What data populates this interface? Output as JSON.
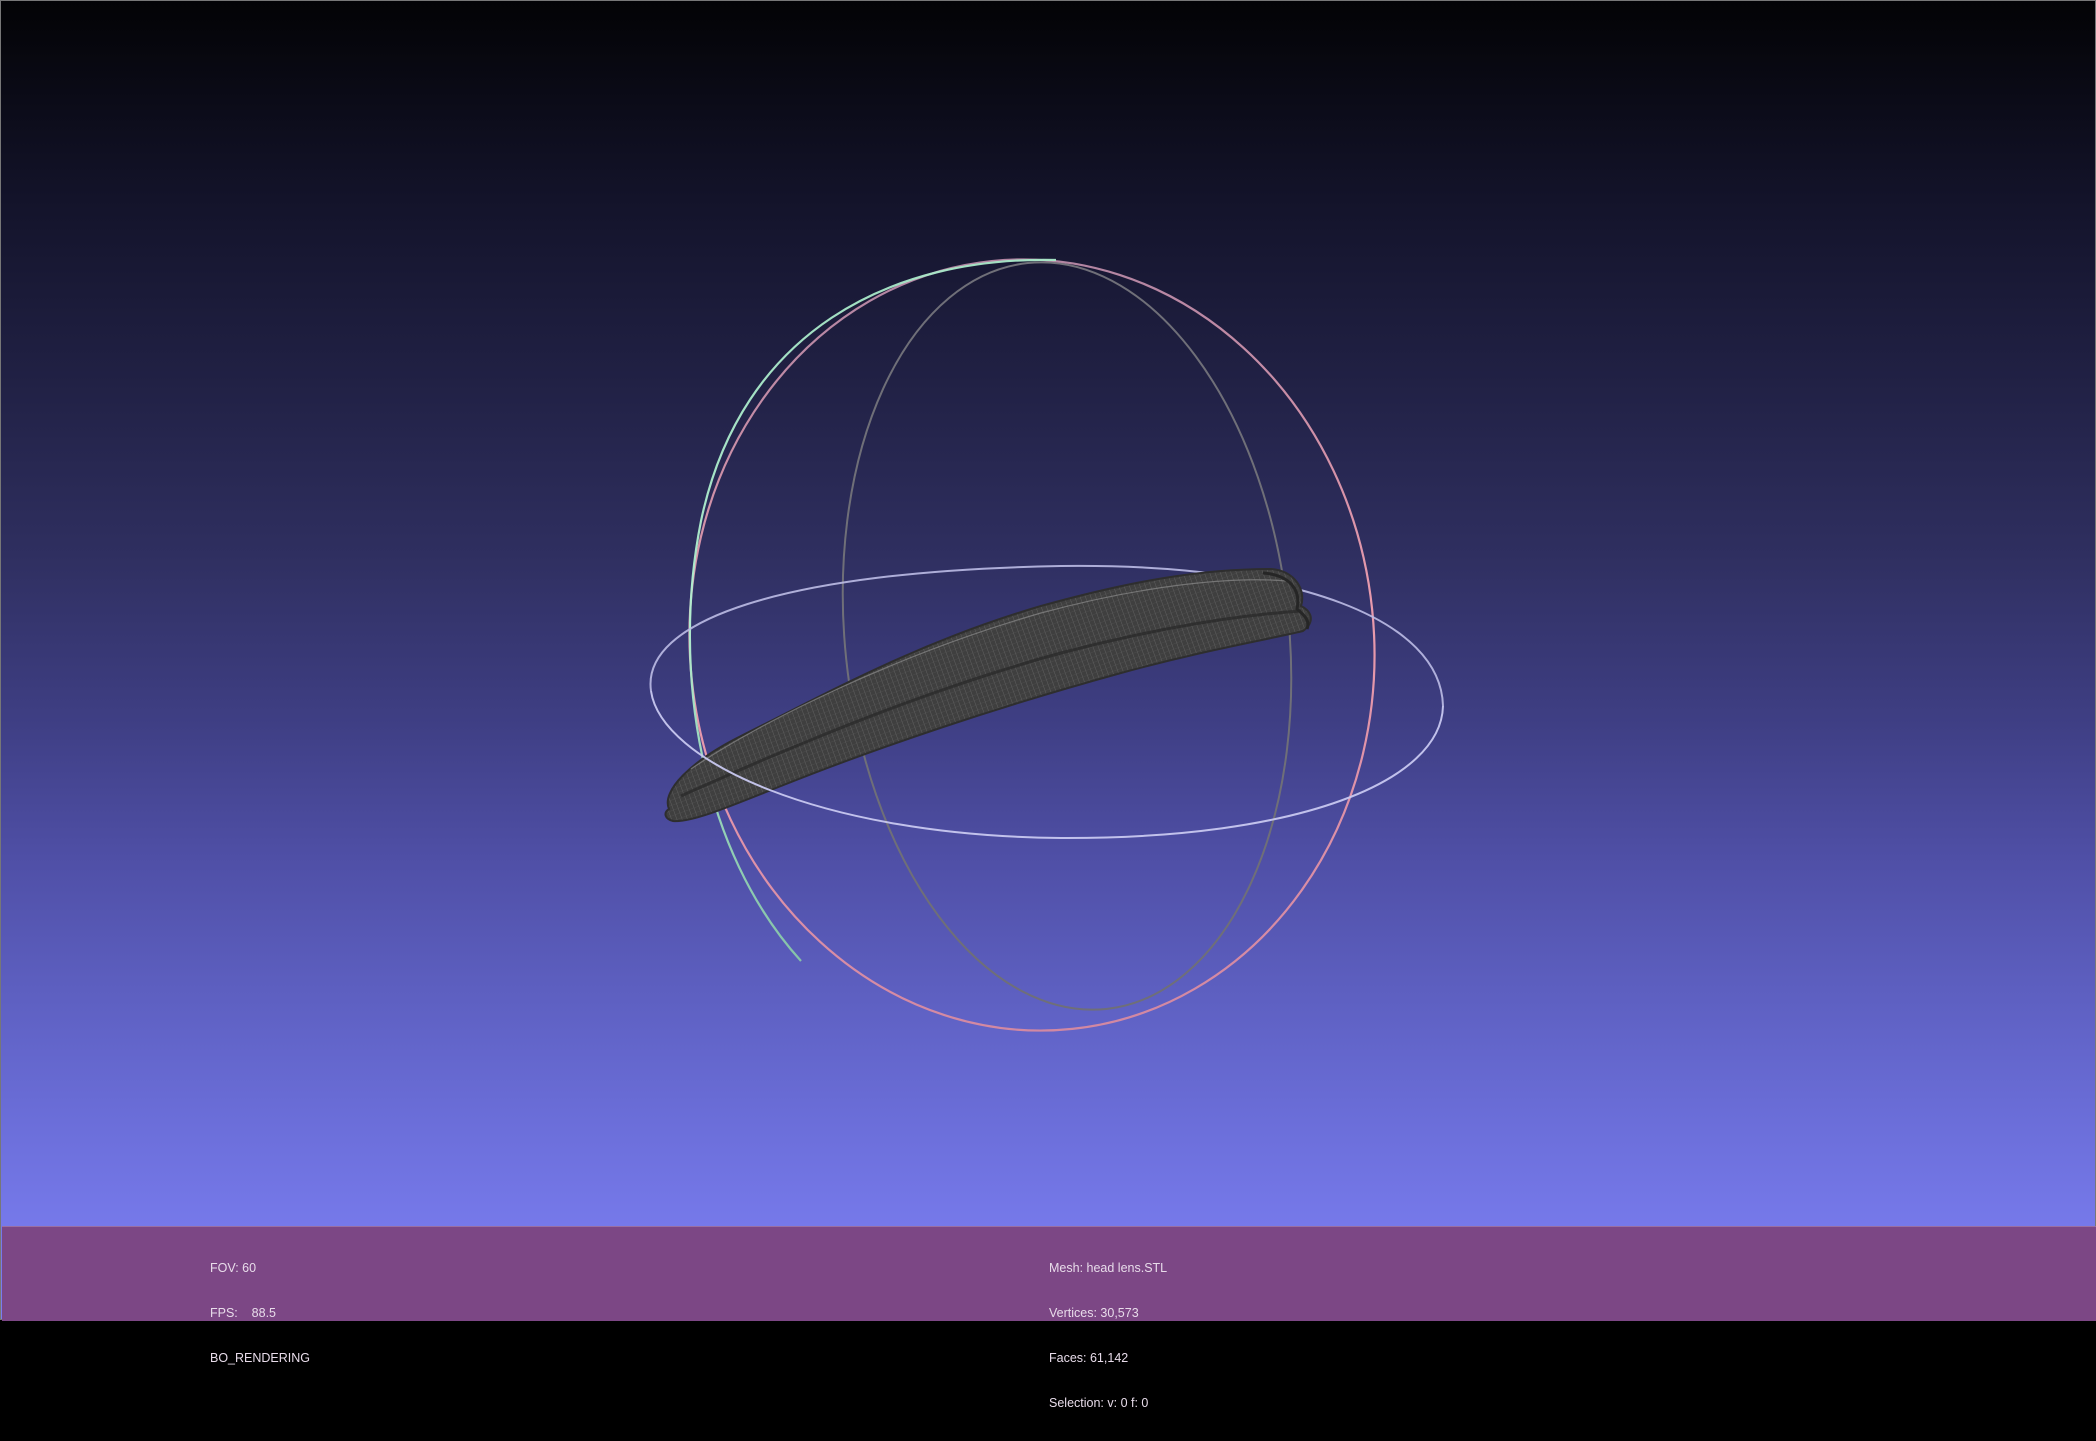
{
  "viewer": {
    "background_top_color": "#030305",
    "background_bottom_color": "#7a7ef0",
    "info_bar_color": "#7c4785",
    "mesh_color": "#4a4a4a",
    "trackball": {
      "x_ring_color": "#e89aa8",
      "y_ring_color": "#9ee8c0",
      "z_ring_color": "#c8c8f0"
    }
  },
  "info_left": {
    "fov": "FOV: 60",
    "fps": "FPS:    88.5",
    "render_mode": "BO_RENDERING"
  },
  "info_right": {
    "mesh": "Mesh: head lens.STL",
    "vertices": "Vertices: 30,573",
    "faces": "Faces: 61,142",
    "selection": "Selection: v: 0 f: 0"
  }
}
